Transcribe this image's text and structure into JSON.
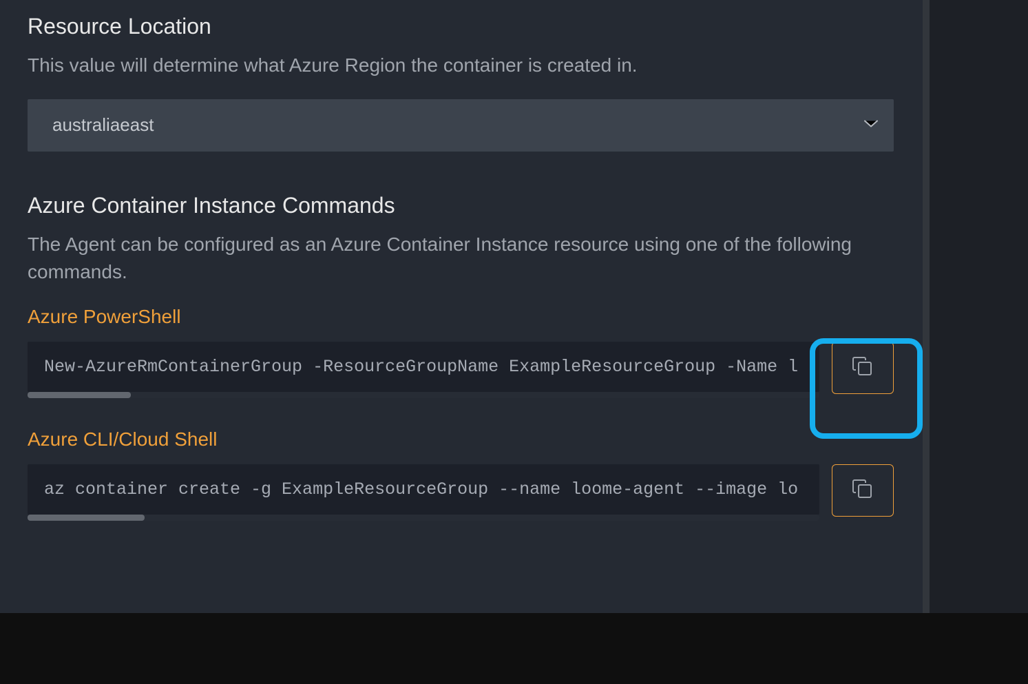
{
  "resourceLocation": {
    "title": "Resource Location",
    "description": "This value will determine what Azure Region the container is created in.",
    "selected": "australiaeast"
  },
  "commands": {
    "title": "Azure Container Instance Commands",
    "description": "The Agent can be configured as an Azure Container Instance resource using one of the following commands.",
    "powershell": {
      "label": "Azure PowerShell",
      "code": "New-AzureRmContainerGroup -ResourceGroupName ExampleResourceGroup -Name l"
    },
    "cli": {
      "label": "Azure CLI/Cloud Shell",
      "code": "az container create -g ExampleResourceGroup --name loome-agent --image lo"
    }
  },
  "icons": {
    "chevron": "chevron-down",
    "copy": "copy"
  }
}
